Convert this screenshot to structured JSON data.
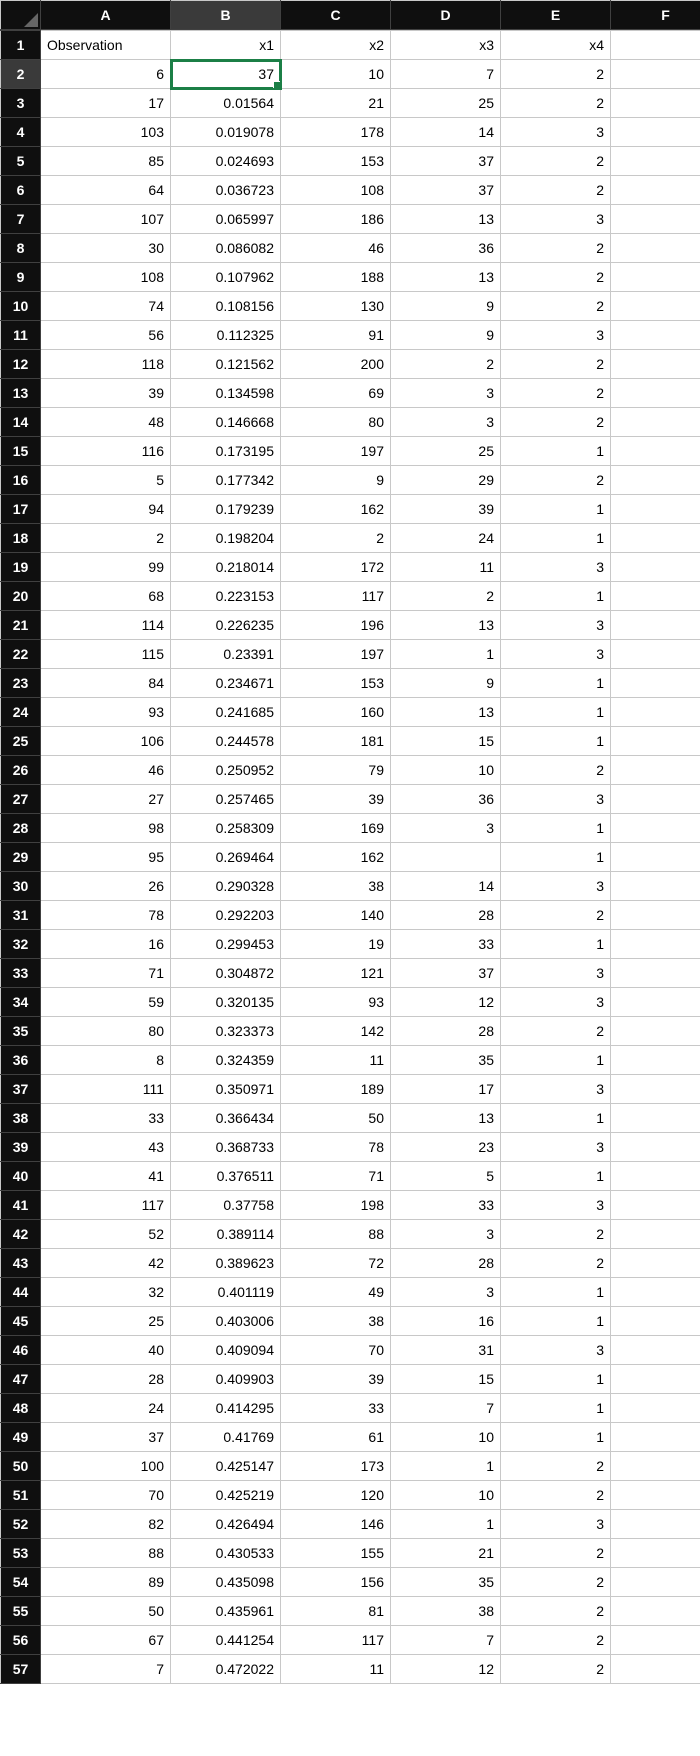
{
  "columns": [
    "A",
    "B",
    "C",
    "D",
    "E",
    "F"
  ],
  "active_cell": {
    "row": 2,
    "col": "B"
  },
  "header_row": {
    "A": {
      "v": "Observation",
      "align": "left"
    },
    "B": {
      "v": "x1"
    },
    "C": {
      "v": "x2"
    },
    "D": {
      "v": "x3"
    },
    "E": {
      "v": "x4"
    },
    "F": {
      "v": ""
    }
  },
  "rows": [
    {
      "n": 1,
      "cells": [
        "__HEADER__"
      ]
    },
    {
      "n": 2,
      "A": "6",
      "B": "37",
      "C": "10",
      "D": "7",
      "E": "2"
    },
    {
      "n": 3,
      "A": "17",
      "B": "0.01564",
      "C": "21",
      "D": "25",
      "E": "2"
    },
    {
      "n": 4,
      "A": "103",
      "B": "0.019078",
      "C": "178",
      "D": "14",
      "E": "3"
    },
    {
      "n": 5,
      "A": "85",
      "B": "0.024693",
      "C": "153",
      "D": "37",
      "E": "2"
    },
    {
      "n": 6,
      "A": "64",
      "B": "0.036723",
      "C": "108",
      "D": "37",
      "E": "2"
    },
    {
      "n": 7,
      "A": "107",
      "B": "0.065997",
      "C": "186",
      "D": "13",
      "E": "3"
    },
    {
      "n": 8,
      "A": "30",
      "B": "0.086082",
      "C": "46",
      "D": "36",
      "E": "2"
    },
    {
      "n": 9,
      "A": "108",
      "B": "0.107962",
      "C": "188",
      "D": "13",
      "E": "2"
    },
    {
      "n": 10,
      "A": "74",
      "B": "0.108156",
      "C": "130",
      "D": "9",
      "E": "2"
    },
    {
      "n": 11,
      "A": "56",
      "B": "0.112325",
      "C": "91",
      "D": "9",
      "E": "3"
    },
    {
      "n": 12,
      "A": "118",
      "B": "0.121562",
      "C": "200",
      "D": "2",
      "E": "2"
    },
    {
      "n": 13,
      "A": "39",
      "B": "0.134598",
      "C": "69",
      "D": "3",
      "E": "2"
    },
    {
      "n": 14,
      "A": "48",
      "B": "0.146668",
      "C": "80",
      "D": "3",
      "E": "2"
    },
    {
      "n": 15,
      "A": "116",
      "B": "0.173195",
      "C": "197",
      "D": "25",
      "E": "1"
    },
    {
      "n": 16,
      "A": "5",
      "B": "0.177342",
      "C": "9",
      "D": "29",
      "E": "2"
    },
    {
      "n": 17,
      "A": "94",
      "B": "0.179239",
      "C": "162",
      "D": "39",
      "E": "1"
    },
    {
      "n": 18,
      "A": "2",
      "B": "0.198204",
      "C": "2",
      "D": "24",
      "E": "1"
    },
    {
      "n": 19,
      "A": "99",
      "B": "0.218014",
      "C": "172",
      "D": "11",
      "E": "3"
    },
    {
      "n": 20,
      "A": "68",
      "B": "0.223153",
      "C": "117",
      "D": "2",
      "E": "1"
    },
    {
      "n": 21,
      "A": "114",
      "B": "0.226235",
      "C": "196",
      "D": "13",
      "E": "3"
    },
    {
      "n": 22,
      "A": "115",
      "B": "0.23391",
      "C": "197",
      "D": "1",
      "E": "3"
    },
    {
      "n": 23,
      "A": "84",
      "B": "0.234671",
      "C": "153",
      "D": "9",
      "E": "1"
    },
    {
      "n": 24,
      "A": "93",
      "B": "0.241685",
      "C": "160",
      "D": "13",
      "E": "1"
    },
    {
      "n": 25,
      "A": "106",
      "B": "0.244578",
      "C": "181",
      "D": "15",
      "E": "1"
    },
    {
      "n": 26,
      "A": "46",
      "B": "0.250952",
      "C": "79",
      "D": "10",
      "E": "2"
    },
    {
      "n": 27,
      "A": "27",
      "B": "0.257465",
      "C": "39",
      "D": "36",
      "E": "3"
    },
    {
      "n": 28,
      "A": "98",
      "B": "0.258309",
      "C": "169",
      "D": "3",
      "E": "1"
    },
    {
      "n": 29,
      "A": "95",
      "B": "0.269464",
      "C": "162",
      "D": "",
      "E": "1"
    },
    {
      "n": 30,
      "A": "26",
      "B": "0.290328",
      "C": "38",
      "D": "14",
      "E": "3"
    },
    {
      "n": 31,
      "A": "78",
      "B": "0.292203",
      "C": "140",
      "D": "28",
      "E": "2"
    },
    {
      "n": 32,
      "A": "16",
      "B": "0.299453",
      "C": "19",
      "D": "33",
      "E": "1"
    },
    {
      "n": 33,
      "A": "71",
      "B": "0.304872",
      "C": "121",
      "D": "37",
      "E": "3"
    },
    {
      "n": 34,
      "A": "59",
      "B": "0.320135",
      "C": "93",
      "D": "12",
      "E": "3"
    },
    {
      "n": 35,
      "A": "80",
      "B": "0.323373",
      "C": "142",
      "D": "28",
      "E": "2"
    },
    {
      "n": 36,
      "A": "8",
      "B": "0.324359",
      "C": "11",
      "D": "35",
      "E": "1"
    },
    {
      "n": 37,
      "A": "111",
      "B": "0.350971",
      "C": "189",
      "D": "17",
      "E": "3"
    },
    {
      "n": 38,
      "A": "33",
      "B": "0.366434",
      "C": "50",
      "D": "13",
      "E": "1"
    },
    {
      "n": 39,
      "A": "43",
      "B": "0.368733",
      "C": "78",
      "D": "23",
      "E": "3"
    },
    {
      "n": 40,
      "A": "41",
      "B": "0.376511",
      "C": "71",
      "D": "5",
      "E": "1"
    },
    {
      "n": 41,
      "A": "117",
      "B": "0.37758",
      "C": "198",
      "D": "33",
      "E": "3"
    },
    {
      "n": 42,
      "A": "52",
      "B": "0.389114",
      "C": "88",
      "D": "3",
      "E": "2"
    },
    {
      "n": 43,
      "A": "42",
      "B": "0.389623",
      "C": "72",
      "D": "28",
      "E": "2"
    },
    {
      "n": 44,
      "A": "32",
      "B": "0.401119",
      "C": "49",
      "D": "3",
      "E": "1"
    },
    {
      "n": 45,
      "A": "25",
      "B": "0.403006",
      "C": "38",
      "D": "16",
      "E": "1"
    },
    {
      "n": 46,
      "A": "40",
      "B": "0.409094",
      "C": "70",
      "D": "31",
      "E": "3"
    },
    {
      "n": 47,
      "A": "28",
      "B": "0.409903",
      "C": "39",
      "D": "15",
      "E": "1"
    },
    {
      "n": 48,
      "A": "24",
      "B": "0.414295",
      "C": "33",
      "D": "7",
      "E": "1"
    },
    {
      "n": 49,
      "A": "37",
      "B": "0.41769",
      "C": "61",
      "D": "10",
      "E": "1"
    },
    {
      "n": 50,
      "A": "100",
      "B": "0.425147",
      "C": "173",
      "D": "1",
      "E": "2"
    },
    {
      "n": 51,
      "A": "70",
      "B": "0.425219",
      "C": "120",
      "D": "10",
      "E": "2"
    },
    {
      "n": 52,
      "A": "82",
      "B": "0.426494",
      "C": "146",
      "D": "1",
      "E": "3"
    },
    {
      "n": 53,
      "A": "88",
      "B": "0.430533",
      "C": "155",
      "D": "21",
      "E": "2"
    },
    {
      "n": 54,
      "A": "89",
      "B": "0.435098",
      "C": "156",
      "D": "35",
      "E": "2"
    },
    {
      "n": 55,
      "A": "50",
      "B": "0.435961",
      "C": "81",
      "D": "38",
      "E": "2"
    },
    {
      "n": 56,
      "A": "67",
      "B": "0.441254",
      "C": "117",
      "D": "7",
      "E": "2"
    },
    {
      "n": 57,
      "A": "7",
      "B": "0.472022",
      "C": "11",
      "D": "12",
      "E": "2"
    }
  ]
}
